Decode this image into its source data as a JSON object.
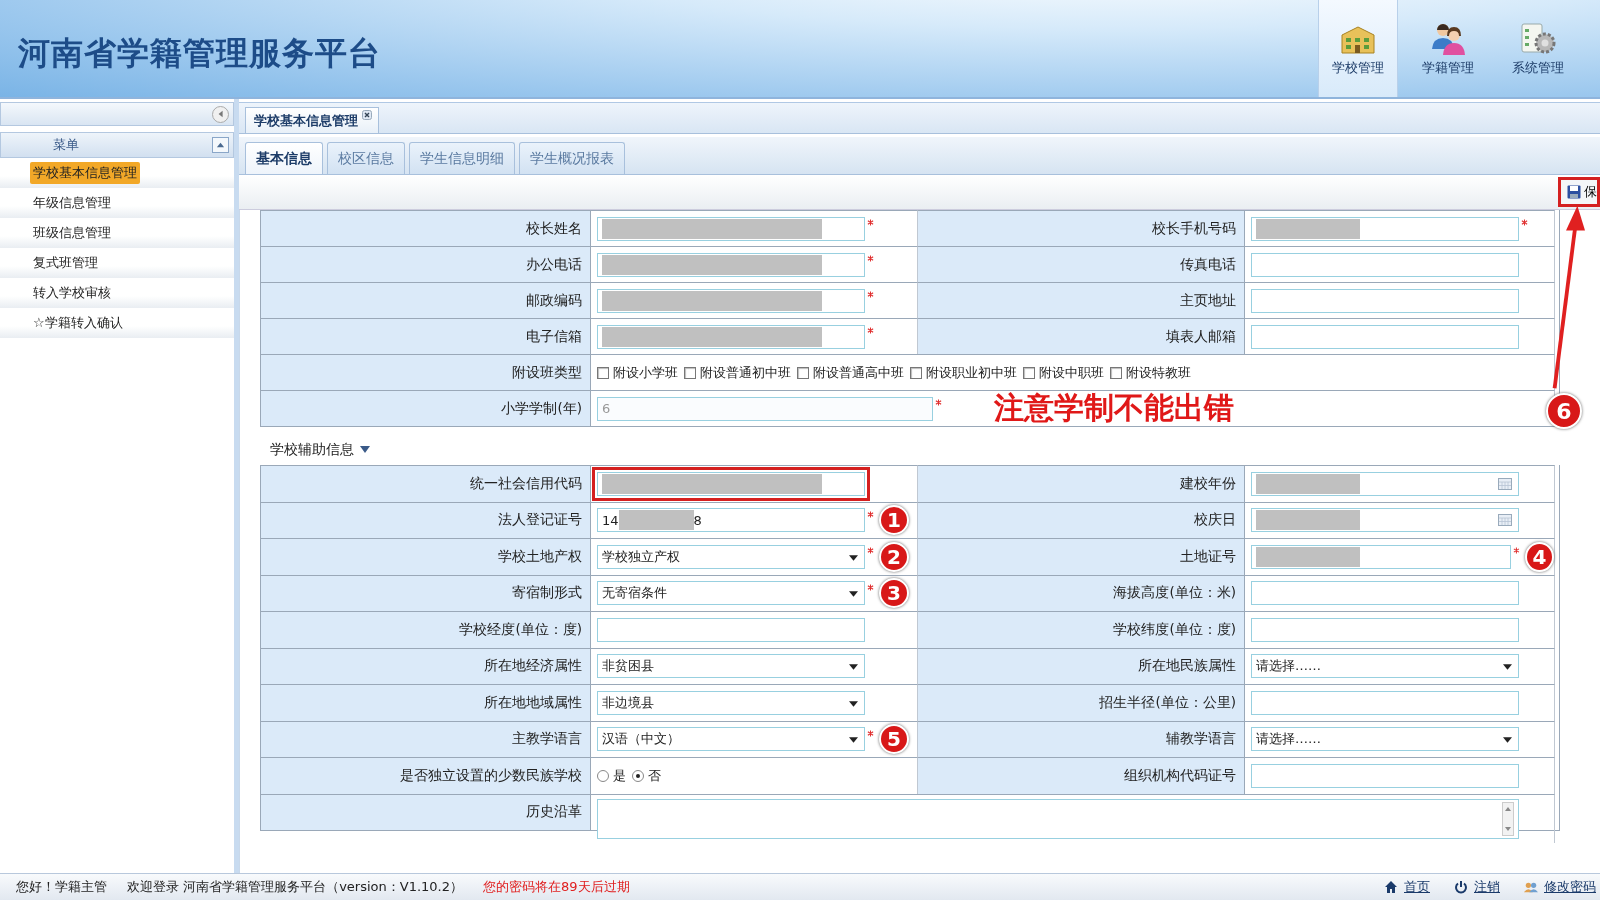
{
  "header": {
    "title": "河南省学籍管理服务平台",
    "nav": [
      {
        "label": "学校管理",
        "selected": true
      },
      {
        "label": "学籍管理",
        "selected": false
      },
      {
        "label": "系统管理",
        "selected": false
      }
    ]
  },
  "sidebar": {
    "title": "菜单",
    "items": [
      {
        "label": "学校基本信息管理",
        "selected": true
      },
      {
        "label": "年级信息管理",
        "selected": false
      },
      {
        "label": "班级信息管理",
        "selected": false
      },
      {
        "label": "复式班管理",
        "selected": false
      },
      {
        "label": "转入学校审核",
        "selected": false
      },
      {
        "label": "☆学籍转入确认",
        "selected": false
      }
    ]
  },
  "page_tab": {
    "label": "学校基本信息管理"
  },
  "tabs": [
    {
      "label": "基本信息",
      "selected": true
    },
    {
      "label": "校区信息",
      "selected": false
    },
    {
      "label": "学生信息明细",
      "selected": false
    },
    {
      "label": "学生概况报表",
      "selected": false
    }
  ],
  "save_button": {
    "label": "保",
    "highlighted": true,
    "marker": "6"
  },
  "form": {
    "sections": [
      {
        "rows": [
          {
            "left": {
              "label": "校长姓名",
              "kind": "text",
              "masked": true,
              "required": true
            },
            "right": {
              "label": "校长手机号码",
              "kind": "text",
              "masked": true,
              "required": true
            }
          },
          {
            "left": {
              "label": "办公电话",
              "kind": "text",
              "masked": true,
              "required": true
            },
            "right": {
              "label": "传真电话",
              "kind": "text"
            }
          },
          {
            "left": {
              "label": "邮政编码",
              "kind": "text",
              "masked": true,
              "required": true
            },
            "right": {
              "label": "主页地址",
              "kind": "text"
            }
          },
          {
            "left": {
              "label": "电子信箱",
              "kind": "text",
              "masked": true,
              "required": true
            },
            "right": {
              "label": "填表人邮箱",
              "kind": "text"
            }
          },
          {
            "full": {
              "label": "附设班类型",
              "kind": "checkboxes",
              "options": [
                {
                  "label": "附设小学班",
                  "checked": false
                },
                {
                  "label": "附设普通初中班",
                  "checked": false
                },
                {
                  "label": "附设普通高中班",
                  "checked": false
                },
                {
                  "label": "附设职业初中班",
                  "checked": false
                },
                {
                  "label": "附设中职班",
                  "checked": false
                },
                {
                  "label": "附设特教班",
                  "checked": false
                }
              ]
            }
          },
          {
            "full": {
              "label": "小学学制(年)",
              "kind": "text",
              "value": "6",
              "disabled": true,
              "required": true,
              "note": "注意学制不能出错"
            }
          }
        ]
      },
      {
        "title": "学校辅助信息",
        "expanded": true,
        "rows": [
          {
            "left": {
              "label": "统一社会信用代码",
              "kind": "text",
              "masked": true,
              "highlighted": true
            },
            "right": {
              "label": "建校年份",
              "kind": "date",
              "masked": true
            }
          },
          {
            "left": {
              "label": "法人登记证号",
              "kind": "text",
              "value": "14",
              "masked": true,
              "suffix": "8",
              "required": true,
              "marker": "1"
            },
            "right": {
              "label": "校庆日",
              "kind": "date",
              "masked": true
            }
          },
          {
            "left": {
              "label": "学校土地产权",
              "kind": "select",
              "value": "学校独立产权",
              "required": true,
              "marker": "2"
            },
            "right": {
              "label": "土地证号",
              "kind": "text",
              "masked": true,
              "required": true,
              "marker": "4"
            }
          },
          {
            "left": {
              "label": "寄宿制形式",
              "kind": "select",
              "value": "无寄宿条件",
              "required": true,
              "marker": "3"
            },
            "right": {
              "label": "海拔高度(单位：米)",
              "kind": "text"
            }
          },
          {
            "left": {
              "label": "学校经度(单位：度)",
              "kind": "text"
            },
            "right": {
              "label": "学校纬度(单位：度)",
              "kind": "text"
            }
          },
          {
            "left": {
              "label": "所在地经济属性",
              "kind": "select",
              "value": "非贫困县"
            },
            "right": {
              "label": "所在地民族属性",
              "kind": "select",
              "value": "请选择……"
            }
          },
          {
            "left": {
              "label": "所在地地域属性",
              "kind": "select",
              "value": "非边境县"
            },
            "right": {
              "label": "招生半径(单位：公里)",
              "kind": "text"
            }
          },
          {
            "left": {
              "label": "主教学语言",
              "kind": "select",
              "value": "汉语（中文）",
              "required": true,
              "marker": "5"
            },
            "right": {
              "label": "辅教学语言",
              "kind": "select",
              "value": "请选择……"
            }
          },
          {
            "left": {
              "label": "是否独立设置的少数民族学校",
              "kind": "radio",
              "options": [
                {
                  "label": "是",
                  "selected": false
                },
                {
                  "label": "否",
                  "selected": true
                }
              ]
            },
            "right": {
              "label": "组织机构代码证号",
              "kind": "text"
            }
          },
          {
            "full": {
              "label": "历史沿革",
              "kind": "textarea"
            }
          }
        ]
      }
    ]
  },
  "status_bar": {
    "user": "您好！学籍主管",
    "welcome": "欢迎登录 河南省学籍管理服务平台（version：V1.10.2）",
    "warning": "您的密码将在89天后过期",
    "links": [
      {
        "label": "首页"
      },
      {
        "label": "注销"
      },
      {
        "label": "修改密码"
      }
    ]
  }
}
